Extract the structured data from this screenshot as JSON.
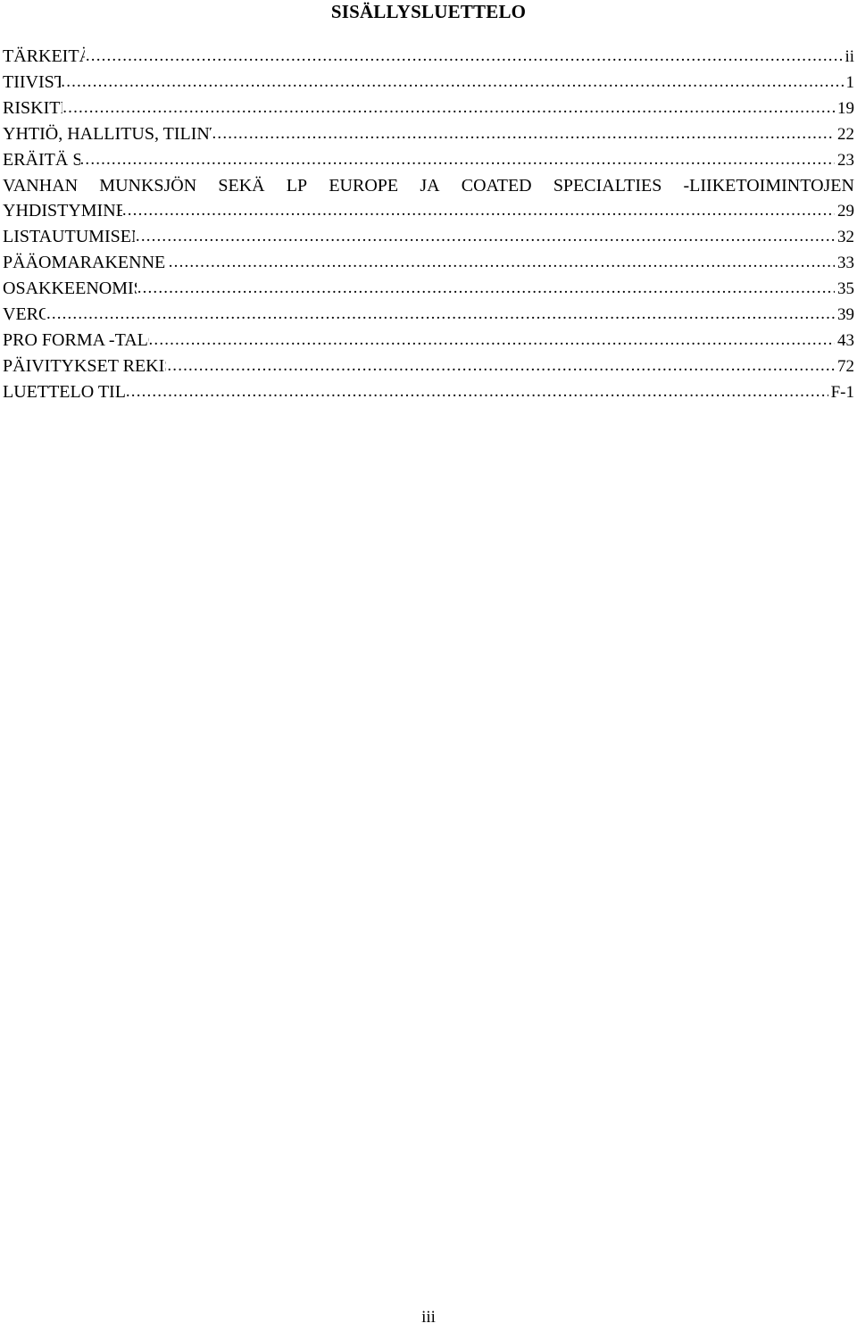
{
  "document": {
    "title": "SISÄLLYSLUETTELO",
    "footer_page_number": "iii"
  },
  "toc": {
    "entries": [
      {
        "label": "TÄRKEITÄ TIETOJA",
        "page": "ii",
        "gap": true
      },
      {
        "label": "TIIVISTELMÄ",
        "page": "1",
        "gap": false
      },
      {
        "label": "RISKITEKIJÄT",
        "page": "19",
        "gap": false
      },
      {
        "label": "YHTIÖ, HALLITUS, TILINTARKASTAJAT JA NEUVONANTAJAT",
        "page": "22",
        "gap": true
      },
      {
        "label": "ERÄITÄ SEIKKOJA",
        "page": "23",
        "gap": false
      }
    ],
    "wide_entry": {
      "line1_words": [
        "VANHAN",
        "MUNKSJÖN",
        "SEKÄ",
        "LP",
        "EUROPE",
        "JA",
        "COATED",
        "SPECIALTIES",
        "-LIIKETOIMINTOJEN"
      ],
      "line2_label": "YHDISTYMINEN MUNKSJÖKSI",
      "page": "29"
    },
    "entries_after": [
      {
        "label": "LISTAUTUMISEN TAUSTA JA SYYT",
        "page": "32",
        "gap": true
      },
      {
        "label": "PÄÄOMARAKENNE JA VELKAANTUNEISUUS",
        "page": "33",
        "gap": true
      },
      {
        "label": "OSAKKEENOMISTAJAN OIKEUDET",
        "page": "35",
        "gap": true
      },
      {
        "label": "VEROTUS",
        "page": "39",
        "gap": true
      },
      {
        "label": "PRO FORMA -TALOUDELLISET TIEDOT",
        "page": "43",
        "gap": false
      },
      {
        "label": "PÄIVITYKSET REKISTERÖINTIASIAKIRJAAN",
        "page": "72",
        "gap": true
      },
      {
        "label": "LUETTELO TILINPÄÄTÖKSISTÄ",
        "page": "F-1",
        "gap": true
      }
    ]
  }
}
